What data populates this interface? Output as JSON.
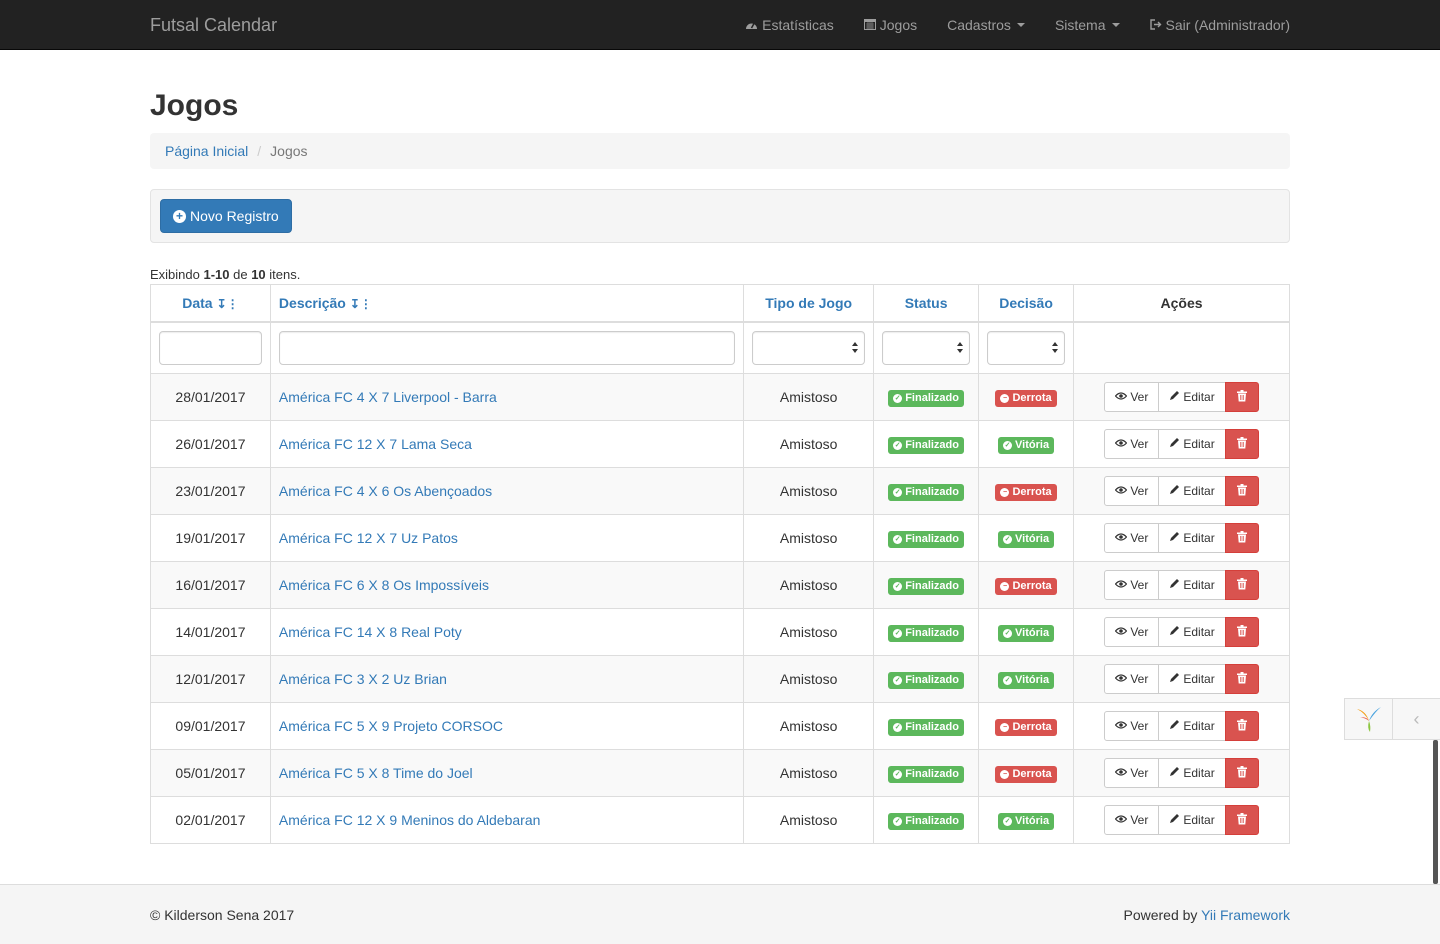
{
  "navbar": {
    "brand": "Futsal Calendar",
    "items": [
      {
        "label": "Estatísticas",
        "icon": "dashboard-icon"
      },
      {
        "label": "Jogos",
        "icon": "calendar-icon"
      },
      {
        "label": "Cadastros",
        "dropdown": true
      },
      {
        "label": "Sistema",
        "dropdown": true
      },
      {
        "label": "Sair (Administrador)",
        "icon": "logout-icon"
      }
    ]
  },
  "page": {
    "title": "Jogos",
    "breadcrumb": {
      "home": "Página Inicial",
      "current": "Jogos"
    },
    "new_button": "Novo Registro",
    "summary": {
      "prefix": "Exibindo ",
      "range": "1-10",
      "middle": " de ",
      "total": "10",
      "suffix": " itens."
    }
  },
  "table": {
    "columns": [
      "Data",
      "Descrição",
      "Tipo de Jogo",
      "Status",
      "Decisão",
      "Ações"
    ],
    "actions": {
      "view": "Ver",
      "edit": "Editar"
    },
    "rows": [
      {
        "date": "28/01/2017",
        "desc": "América FC 4 X 7 Liverpool - Barra",
        "type": "Amistoso",
        "status": "Finalizado",
        "decision": "Derrota"
      },
      {
        "date": "26/01/2017",
        "desc": "América FC 12 X 7 Lama Seca",
        "type": "Amistoso",
        "status": "Finalizado",
        "decision": "Vitória"
      },
      {
        "date": "23/01/2017",
        "desc": "América FC 4 X 6 Os Abençoados",
        "type": "Amistoso",
        "status": "Finalizado",
        "decision": "Derrota"
      },
      {
        "date": "19/01/2017",
        "desc": "América FC 12 X 7 Uz Patos",
        "type": "Amistoso",
        "status": "Finalizado",
        "decision": "Vitória"
      },
      {
        "date": "16/01/2017",
        "desc": "América FC 6 X 8 Os Impossíveis",
        "type": "Amistoso",
        "status": "Finalizado",
        "decision": "Derrota"
      },
      {
        "date": "14/01/2017",
        "desc": "América FC 14 X 8 Real Poty",
        "type": "Amistoso",
        "status": "Finalizado",
        "decision": "Vitória"
      },
      {
        "date": "12/01/2017",
        "desc": "América FC 3 X 2 Uz Brian",
        "type": "Amistoso",
        "status": "Finalizado",
        "decision": "Vitória"
      },
      {
        "date": "09/01/2017",
        "desc": "América FC 5 X 9 Projeto CORSOC",
        "type": "Amistoso",
        "status": "Finalizado",
        "decision": "Derrota"
      },
      {
        "date": "05/01/2017",
        "desc": "América FC 5 X 8 Time do Joel",
        "type": "Amistoso",
        "status": "Finalizado",
        "decision": "Derrota"
      },
      {
        "date": "02/01/2017",
        "desc": "América FC 12 X 9 Meninos do Aldebaran",
        "type": "Amistoso",
        "status": "Finalizado",
        "decision": "Vitória"
      }
    ]
  },
  "footer": {
    "copyright": "© Kilderson Sena 2017",
    "powered_prefix": "Powered by ",
    "powered_link": "Yii Framework"
  },
  "colors": {
    "primary": "#337ab7",
    "success": "#5cb85c",
    "danger": "#d9534f",
    "navbar": "#222222"
  }
}
